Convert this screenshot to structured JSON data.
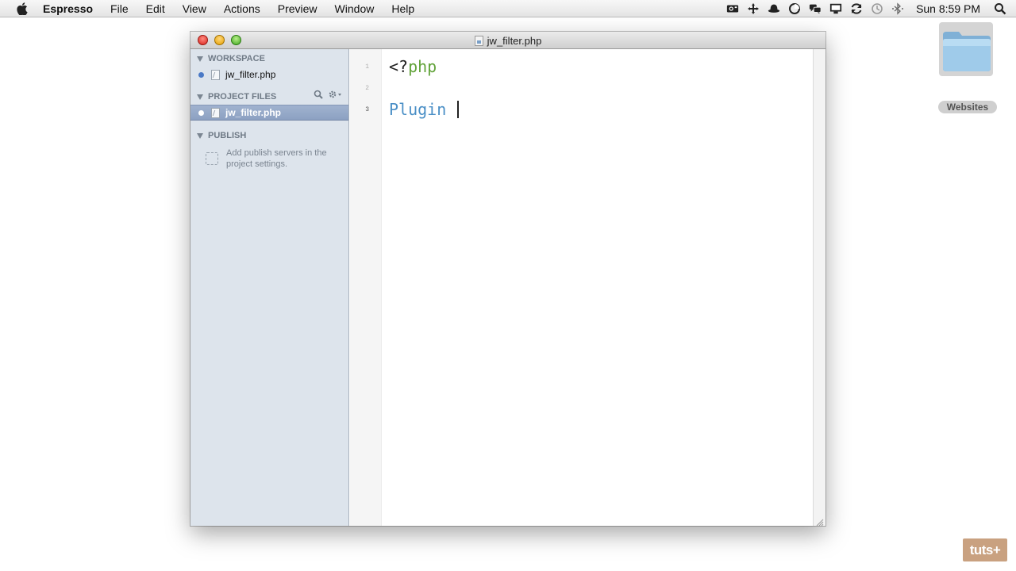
{
  "menubar": {
    "app_name": "Espresso",
    "items": [
      "File",
      "Edit",
      "View",
      "Actions",
      "Preview",
      "Window",
      "Help"
    ],
    "clock": "Sun 8:59 PM"
  },
  "desktop": {
    "folder_label": "Websites"
  },
  "window": {
    "title": "jw_filter.php"
  },
  "sidebar": {
    "workspace": {
      "header": "WORKSPACE",
      "file": "jw_filter.php"
    },
    "project_files": {
      "header": "PROJECT FILES",
      "file": "jw_filter.php"
    },
    "publish": {
      "header": "PUBLISH",
      "hint": "Add publish servers in the project settings."
    }
  },
  "editor": {
    "line_numbers": [
      "1",
      "2",
      "3"
    ],
    "current_line": 3,
    "lines": {
      "l1_bracket": "<?",
      "l1_keyword": "php",
      "l3_text": "Plugin"
    }
  },
  "badge": {
    "text": "tuts+"
  },
  "colors": {
    "php_keyword": "#62a33a",
    "plain_text": "#4a8fc6",
    "selection": "#8ca1c2",
    "sidebar_bg": "#dde4ec"
  }
}
